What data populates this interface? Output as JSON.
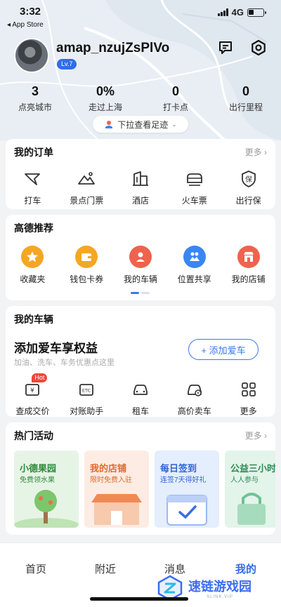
{
  "status": {
    "time": "3:32",
    "back_app": "◂ App Store",
    "network": "4G"
  },
  "profile": {
    "username": "amap_nzujZsPlVo",
    "level": "Lv.7"
  },
  "stats": [
    {
      "value": "3",
      "label": "点亮城市"
    },
    {
      "value": "0%",
      "label": "走过上海"
    },
    {
      "value": "0",
      "label": "打卡点"
    },
    {
      "value": "0",
      "label": "出行里程"
    }
  ],
  "pull_hint": "下拉查看足迹",
  "orders": {
    "title": "我的订单",
    "more": "更多",
    "items": [
      {
        "label": "打车",
        "icon": "taxi-icon"
      },
      {
        "label": "景点门票",
        "icon": "scenic-ticket-icon"
      },
      {
        "label": "酒店",
        "icon": "hotel-icon"
      },
      {
        "label": "火车票",
        "icon": "train-icon"
      },
      {
        "label": "出行保",
        "icon": "insurance-shield-icon"
      }
    ]
  },
  "recommend": {
    "title": "高德推荐",
    "items": [
      {
        "label": "收藏夹",
        "icon": "star-icon",
        "color": "#f5a623"
      },
      {
        "label": "钱包卡券",
        "icon": "wallet-icon",
        "color": "#f5a623"
      },
      {
        "label": "我的车辆",
        "icon": "car-user-icon",
        "color": "#f0624d"
      },
      {
        "label": "位置共享",
        "icon": "location-share-icon",
        "color": "#3a86f0"
      },
      {
        "label": "我的店铺",
        "icon": "shop-icon",
        "color": "#f0624d"
      }
    ]
  },
  "vehicle": {
    "title": "我的车辆",
    "promo_title": "添加爱车享权益",
    "promo_sub": "加油、洗车、车务优惠点这里",
    "add_button": "+ 添加爱车",
    "hot_badge": "Hot",
    "items": [
      {
        "label": "查成交价",
        "icon": "price-tag-icon"
      },
      {
        "label": "对账助手",
        "icon": "etc-icon"
      },
      {
        "label": "租车",
        "icon": "rent-car-icon"
      },
      {
        "label": "高价卖车",
        "icon": "sell-car-icon"
      },
      {
        "label": "更多",
        "icon": "grid-more-icon"
      }
    ]
  },
  "activities": {
    "title": "热门活动",
    "more": "更多",
    "items": [
      {
        "title": "小德果园",
        "sub": "免费领水果",
        "bg": "#e6f4e6",
        "color": "#2f8a3b"
      },
      {
        "title": "我的店铺",
        "sub": "限时免费入驻",
        "bg": "#fdece3",
        "color": "#e06a2c"
      },
      {
        "title": "每日签到",
        "sub": "连签7天得好礼",
        "bg": "#e4eefc",
        "color": "#2f64d6"
      },
      {
        "title": "公益三小时",
        "sub": "人人参与",
        "bg": "#e3f4ea",
        "color": "#2f8a55"
      }
    ]
  },
  "tabs": [
    {
      "label": "首页",
      "active": false
    },
    {
      "label": "附近",
      "active": false
    },
    {
      "label": "消息",
      "active": false
    },
    {
      "label": "我的",
      "active": true
    }
  ],
  "watermark": {
    "text": "速链游戏园",
    "sub": "SLINK.VIP"
  },
  "colors": {
    "accent": "#2f6ee8",
    "tab_active": "#2f6ee8"
  }
}
